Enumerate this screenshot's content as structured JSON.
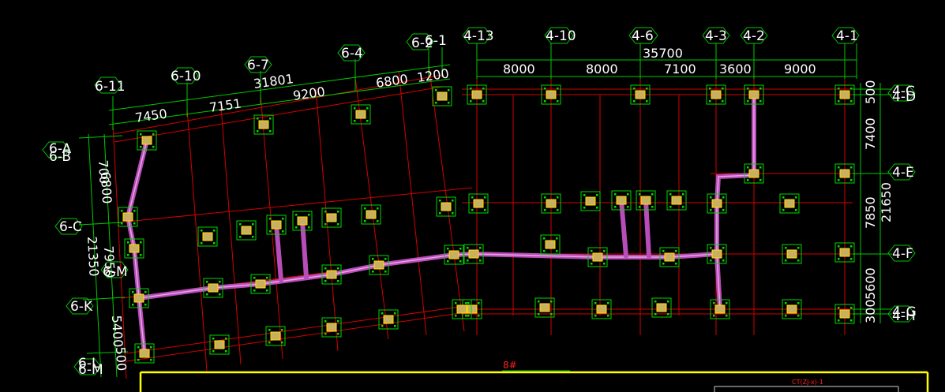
{
  "axes_top": [
    "4-13",
    "4-10",
    "4-6",
    "4-3",
    "4-2",
    "4-1"
  ],
  "axes_right": [
    "4-C",
    "4-D",
    "4-E",
    "4-F",
    "4-G",
    "4-H"
  ],
  "axes_skew_top": [
    "6-11",
    "6-10",
    "6-7",
    "6-4",
    "6-2",
    "6-1"
  ],
  "axes_left": [
    "6-A",
    "6-B",
    "6-C",
    "6-M",
    "6-K",
    "6-L",
    "6-M"
  ],
  "dims_top_total": "35700",
  "dims_top": [
    "8000",
    "8000",
    "7100",
    "3600",
    "9000"
  ],
  "dims_skew_total": "31801",
  "dims_skew": [
    "7450",
    "7151",
    "9200",
    "6800",
    "1200"
  ],
  "dims_right": [
    "500",
    "7400",
    "7850",
    "5600",
    "300"
  ],
  "dims_right_total": "21650",
  "dims_left": [
    "700",
    "6800",
    "7950",
    "5400",
    "500"
  ],
  "dims_left_total": "21350",
  "drawing_title": "8#",
  "table_title": "CT(ZJ-x)-1"
}
